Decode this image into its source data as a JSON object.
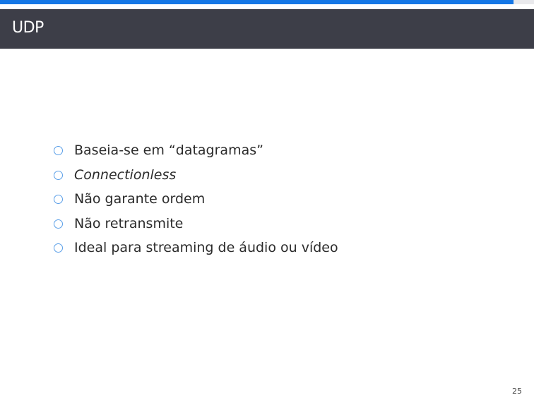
{
  "progress": {
    "fraction": 0.962,
    "color": "#1577e6"
  },
  "header": {
    "title": "UDP",
    "background": "#3d3e48"
  },
  "bullets": [
    {
      "text": "Baseia-se em “datagramas”",
      "italic": false
    },
    {
      "text": "Connectionless",
      "italic": true
    },
    {
      "text": "Não garante ordem",
      "italic": false
    },
    {
      "text": "Não retransmite",
      "italic": false
    },
    {
      "text": "Ideal para streaming de áudio ou vídeo",
      "italic": false
    }
  ],
  "footer": {
    "page_number": "25"
  }
}
